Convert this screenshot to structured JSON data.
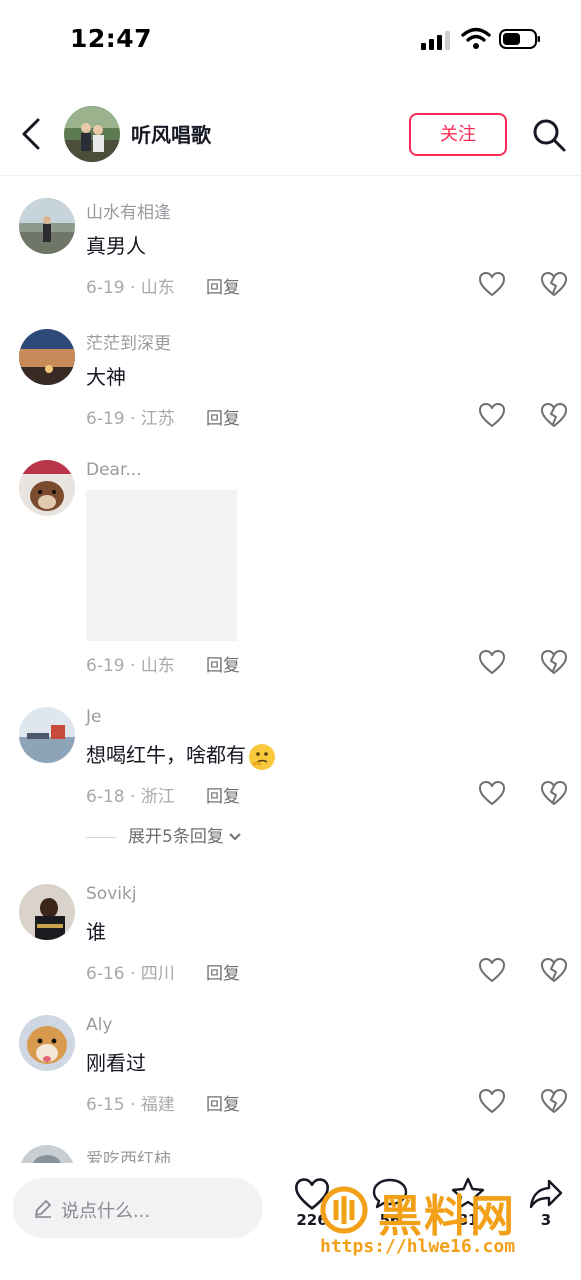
{
  "status_bar": {
    "time": "12:47"
  },
  "header": {
    "name": "听风唱歌",
    "follow_label": "关注"
  },
  "reply_label": "回复",
  "comments": [
    {
      "user": "山水有相逢",
      "text": "真男人",
      "meta": "6-19 · 山东"
    },
    {
      "user": "茫茫到深更",
      "text": "大神",
      "meta": "6-19 · 江苏"
    },
    {
      "user": "Dear...",
      "text": "",
      "meta": "6-19 · 山东"
    },
    {
      "user": "Je",
      "text": "想喝红牛，啥都有",
      "meta": "6-18 · 浙江",
      "expand": "展开5条回复"
    },
    {
      "user": "Sovikj",
      "text": "谁",
      "meta": "6-16 · 四川"
    },
    {
      "user": "Aly",
      "text": "刚看过",
      "meta": "6-15 · 福建"
    },
    {
      "user": "爱吃西红柿",
      "text": "",
      "meta": ""
    }
  ],
  "bottom_bar": {
    "input_placeholder": "说点什么...",
    "like_count": "226",
    "comment_count": "56",
    "favorite_count": "81",
    "share_count": "3"
  },
  "watermark": {
    "text": "黑料网",
    "url": "https://hlwe16.com"
  },
  "colors": {
    "accent": "#fe2c55",
    "watermark": "#f3a019"
  }
}
